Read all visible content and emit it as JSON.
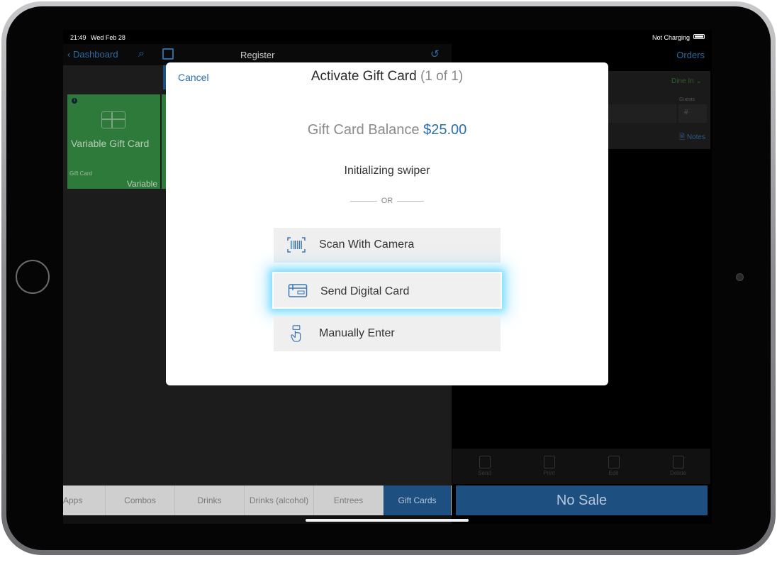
{
  "status_bar": {
    "time": "21:49",
    "date": "Wed Feb 28",
    "charging": "Not Charging"
  },
  "left_nav": {
    "back_label": "Dashboard",
    "title": "Register"
  },
  "right_nav": {
    "orders_label": "Orders"
  },
  "product_tile": {
    "name": "Variable Gift Card",
    "category": "Gift Card",
    "price": "Variable",
    "info": "i"
  },
  "order_panel": {
    "dine_in": "Dine In",
    "guests_label": "Guests",
    "guests_placeholder": "#",
    "notes_label": "Notes"
  },
  "categories": [
    {
      "label": "Apps"
    },
    {
      "label": "Combos"
    },
    {
      "label": "Drinks"
    },
    {
      "label": "Drinks (alcohol)"
    },
    {
      "label": "Entrees"
    },
    {
      "label": "Gift Cards",
      "active": true
    }
  ],
  "actions": [
    {
      "label": "Send"
    },
    {
      "label": "Print"
    },
    {
      "label": "Edit"
    },
    {
      "label": "Delete"
    }
  ],
  "primary_button": {
    "label": "No Sale"
  },
  "modal": {
    "cancel_label": "Cancel",
    "title": "Activate Gift Card",
    "count": "(1 of 1)",
    "balance_label": "Gift Card Balance",
    "balance_amount": "$25.00",
    "swiper_status": "Initializing swiper",
    "divider_text": "OR",
    "options": [
      {
        "label": "Scan With Camera",
        "icon": "barcode-icon"
      },
      {
        "label": "Send Digital Card",
        "icon": "gift-card-icon",
        "highlighted": true
      },
      {
        "label": "Manually Enter",
        "icon": "hand-pointer-icon"
      }
    ]
  },
  "colors": {
    "accent": "#2a6db0",
    "highlight_glow": "#5ed4ff",
    "tile_green": "#2e7a3a",
    "active_tab": "#1d4f80"
  }
}
